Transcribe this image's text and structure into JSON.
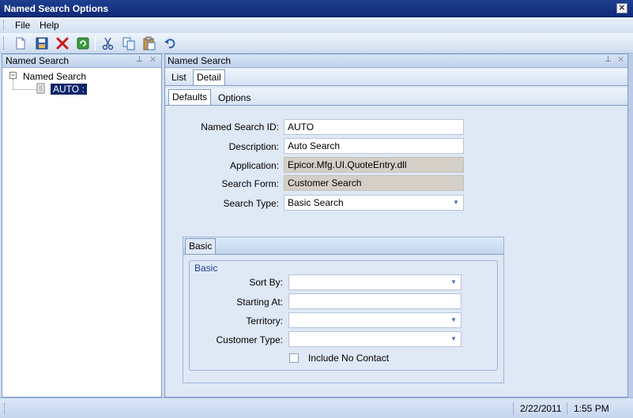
{
  "window": {
    "title": "Named Search Options"
  },
  "menu": {
    "items": [
      "File",
      "Help"
    ]
  },
  "toolbar": {
    "buttons": [
      "new-icon",
      "save-icon",
      "delete-icon",
      "refresh-icon",
      "cut-icon",
      "copy-icon",
      "paste-icon",
      "undo-icon"
    ]
  },
  "left_pane": {
    "title": "Named Search",
    "tree": {
      "root": "Named Search",
      "child": "AUTO :"
    }
  },
  "right_pane": {
    "title": "Named Search",
    "tabs": [
      "List",
      "Detail"
    ],
    "active_tab": "Detail",
    "subtabs": [
      "Defaults",
      "Options"
    ],
    "active_subtab": "Defaults",
    "form": {
      "named_search_id": {
        "label": "Named Search ID:",
        "value": "AUTO"
      },
      "description": {
        "label": "Description:",
        "value": "Auto Search"
      },
      "application": {
        "label": "Application:",
        "value": "Epicor.Mfg.UI.QuoteEntry.dll"
      },
      "search_form": {
        "label": "Search Form:",
        "value": "Customer Search"
      },
      "search_type": {
        "label": "Search Type:",
        "value": "Basic Search"
      }
    },
    "basic": {
      "tab_label": "Basic",
      "group_title": "Basic",
      "sort_by": {
        "label": "Sort By:",
        "value": ""
      },
      "starting_at": {
        "label": "Starting At:",
        "value": ""
      },
      "territory": {
        "label": "Territory:",
        "value": ""
      },
      "customer_type": {
        "label": "Customer Type:",
        "value": ""
      },
      "include_no_contact": {
        "label": "Include No Contact",
        "checked": false
      }
    }
  },
  "status": {
    "date": "2/22/2011",
    "time": "1:55 PM"
  },
  "colors": {
    "title_bar": "#0f2a78",
    "selection": "#0a246a",
    "accent": "#1f3f8f"
  }
}
